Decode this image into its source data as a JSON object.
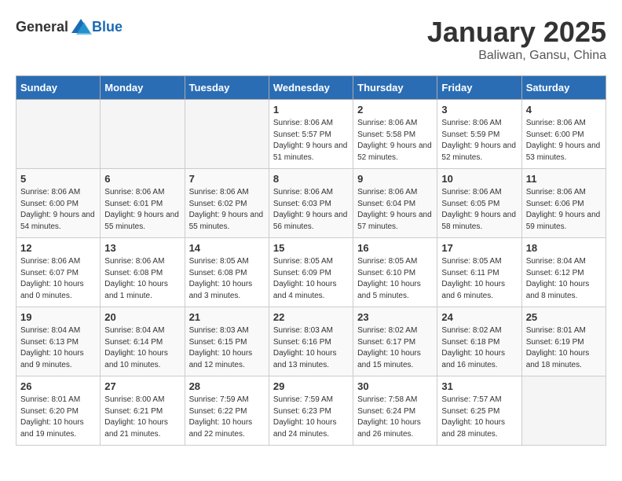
{
  "header": {
    "logo_general": "General",
    "logo_blue": "Blue",
    "month": "January 2025",
    "location": "Baliwan, Gansu, China"
  },
  "days_of_week": [
    "Sunday",
    "Monday",
    "Tuesday",
    "Wednesday",
    "Thursday",
    "Friday",
    "Saturday"
  ],
  "weeks": [
    [
      {
        "day": "",
        "info": ""
      },
      {
        "day": "",
        "info": ""
      },
      {
        "day": "",
        "info": ""
      },
      {
        "day": "1",
        "info": "Sunrise: 8:06 AM\nSunset: 5:57 PM\nDaylight: 9 hours and 51 minutes."
      },
      {
        "day": "2",
        "info": "Sunrise: 8:06 AM\nSunset: 5:58 PM\nDaylight: 9 hours and 52 minutes."
      },
      {
        "day": "3",
        "info": "Sunrise: 8:06 AM\nSunset: 5:59 PM\nDaylight: 9 hours and 52 minutes."
      },
      {
        "day": "4",
        "info": "Sunrise: 8:06 AM\nSunset: 6:00 PM\nDaylight: 9 hours and 53 minutes."
      }
    ],
    [
      {
        "day": "5",
        "info": "Sunrise: 8:06 AM\nSunset: 6:00 PM\nDaylight: 9 hours and 54 minutes."
      },
      {
        "day": "6",
        "info": "Sunrise: 8:06 AM\nSunset: 6:01 PM\nDaylight: 9 hours and 55 minutes."
      },
      {
        "day": "7",
        "info": "Sunrise: 8:06 AM\nSunset: 6:02 PM\nDaylight: 9 hours and 55 minutes."
      },
      {
        "day": "8",
        "info": "Sunrise: 8:06 AM\nSunset: 6:03 PM\nDaylight: 9 hours and 56 minutes."
      },
      {
        "day": "9",
        "info": "Sunrise: 8:06 AM\nSunset: 6:04 PM\nDaylight: 9 hours and 57 minutes."
      },
      {
        "day": "10",
        "info": "Sunrise: 8:06 AM\nSunset: 6:05 PM\nDaylight: 9 hours and 58 minutes."
      },
      {
        "day": "11",
        "info": "Sunrise: 8:06 AM\nSunset: 6:06 PM\nDaylight: 9 hours and 59 minutes."
      }
    ],
    [
      {
        "day": "12",
        "info": "Sunrise: 8:06 AM\nSunset: 6:07 PM\nDaylight: 10 hours and 0 minutes."
      },
      {
        "day": "13",
        "info": "Sunrise: 8:06 AM\nSunset: 6:08 PM\nDaylight: 10 hours and 1 minute."
      },
      {
        "day": "14",
        "info": "Sunrise: 8:05 AM\nSunset: 6:08 PM\nDaylight: 10 hours and 3 minutes."
      },
      {
        "day": "15",
        "info": "Sunrise: 8:05 AM\nSunset: 6:09 PM\nDaylight: 10 hours and 4 minutes."
      },
      {
        "day": "16",
        "info": "Sunrise: 8:05 AM\nSunset: 6:10 PM\nDaylight: 10 hours and 5 minutes."
      },
      {
        "day": "17",
        "info": "Sunrise: 8:05 AM\nSunset: 6:11 PM\nDaylight: 10 hours and 6 minutes."
      },
      {
        "day": "18",
        "info": "Sunrise: 8:04 AM\nSunset: 6:12 PM\nDaylight: 10 hours and 8 minutes."
      }
    ],
    [
      {
        "day": "19",
        "info": "Sunrise: 8:04 AM\nSunset: 6:13 PM\nDaylight: 10 hours and 9 minutes."
      },
      {
        "day": "20",
        "info": "Sunrise: 8:04 AM\nSunset: 6:14 PM\nDaylight: 10 hours and 10 minutes."
      },
      {
        "day": "21",
        "info": "Sunrise: 8:03 AM\nSunset: 6:15 PM\nDaylight: 10 hours and 12 minutes."
      },
      {
        "day": "22",
        "info": "Sunrise: 8:03 AM\nSunset: 6:16 PM\nDaylight: 10 hours and 13 minutes."
      },
      {
        "day": "23",
        "info": "Sunrise: 8:02 AM\nSunset: 6:17 PM\nDaylight: 10 hours and 15 minutes."
      },
      {
        "day": "24",
        "info": "Sunrise: 8:02 AM\nSunset: 6:18 PM\nDaylight: 10 hours and 16 minutes."
      },
      {
        "day": "25",
        "info": "Sunrise: 8:01 AM\nSunset: 6:19 PM\nDaylight: 10 hours and 18 minutes."
      }
    ],
    [
      {
        "day": "26",
        "info": "Sunrise: 8:01 AM\nSunset: 6:20 PM\nDaylight: 10 hours and 19 minutes."
      },
      {
        "day": "27",
        "info": "Sunrise: 8:00 AM\nSunset: 6:21 PM\nDaylight: 10 hours and 21 minutes."
      },
      {
        "day": "28",
        "info": "Sunrise: 7:59 AM\nSunset: 6:22 PM\nDaylight: 10 hours and 22 minutes."
      },
      {
        "day": "29",
        "info": "Sunrise: 7:59 AM\nSunset: 6:23 PM\nDaylight: 10 hours and 24 minutes."
      },
      {
        "day": "30",
        "info": "Sunrise: 7:58 AM\nSunset: 6:24 PM\nDaylight: 10 hours and 26 minutes."
      },
      {
        "day": "31",
        "info": "Sunrise: 7:57 AM\nSunset: 6:25 PM\nDaylight: 10 hours and 28 minutes."
      },
      {
        "day": "",
        "info": ""
      }
    ]
  ]
}
